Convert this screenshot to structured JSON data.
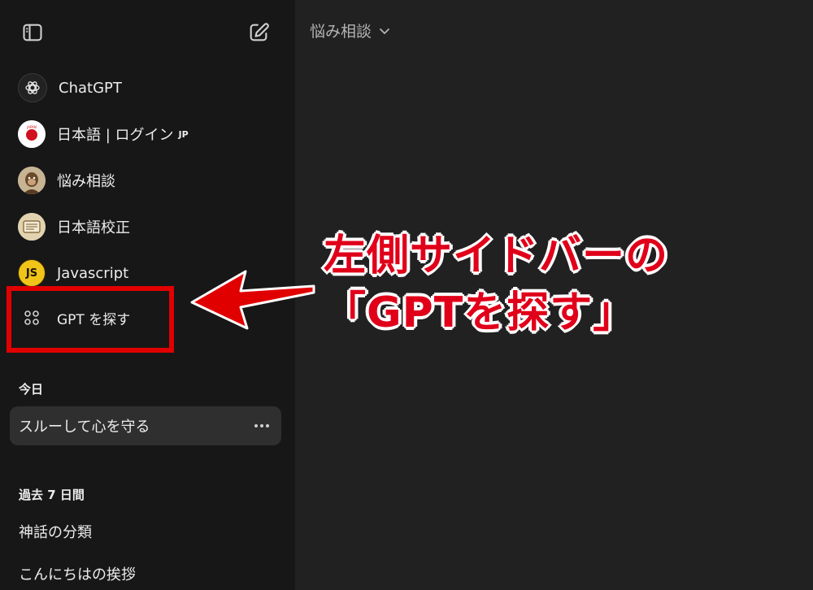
{
  "sidebar": {
    "gpts": [
      {
        "label": "ChatGPT",
        "icon": "openai-logo-icon"
      },
      {
        "label": "日本語 | ログイン",
        "badge": "JP",
        "icon": "japan-flag-avatar-icon"
      },
      {
        "label": "悩み相談",
        "icon": "monkey-avatar-icon"
      },
      {
        "label": "日本語校正",
        "icon": "scroll-avatar-icon"
      },
      {
        "label": "Javascript",
        "icon_text": "JS",
        "icon": "javascript-avatar-icon"
      },
      {
        "label": "GPT を探す",
        "icon": "explore-grid-icon"
      }
    ],
    "sections": [
      {
        "title": "今日",
        "chats": [
          {
            "label": "スルーして心を守る",
            "active": true
          }
        ]
      },
      {
        "title": "過去 7 日間",
        "chats": [
          {
            "label": "神話の分類"
          },
          {
            "label": "こんにちはの挨拶"
          }
        ]
      }
    ]
  },
  "main": {
    "model_selector": "悩み相談"
  },
  "annotation": {
    "line1": "左側サイドバーの",
    "line2": "「GPTを探す」"
  },
  "colors": {
    "sidebar_bg": "#171717",
    "main_bg": "#212121",
    "annotation_red": "#e0001a",
    "js_yellow": "#f0c419"
  }
}
